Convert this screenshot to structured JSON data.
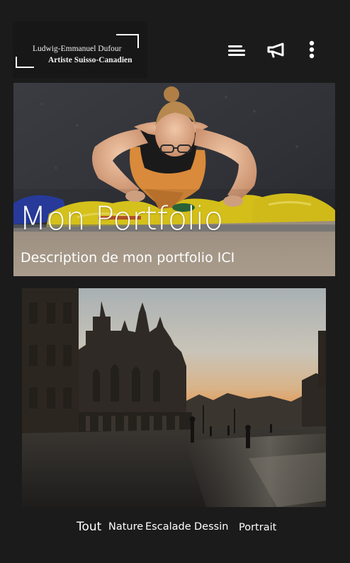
{
  "logo": {
    "name": "Ludwig-Emmanuel Dufour",
    "subtitle": "Artiste Suisso-Canadien"
  },
  "nav": {
    "icons": [
      "menu-icon",
      "megaphone-icon",
      "more-vertical-icon"
    ]
  },
  "hero": {
    "title": "Mon Portfolio",
    "description": "Description de mon portfolio ICI"
  },
  "filters": [
    "Tout",
    "Nature",
    "Escalade",
    "Dessin",
    "Portrait"
  ],
  "colors": {
    "background": "#1b1b1b",
    "text": "#ffffff",
    "hold_yellow": "#e8d21f"
  }
}
